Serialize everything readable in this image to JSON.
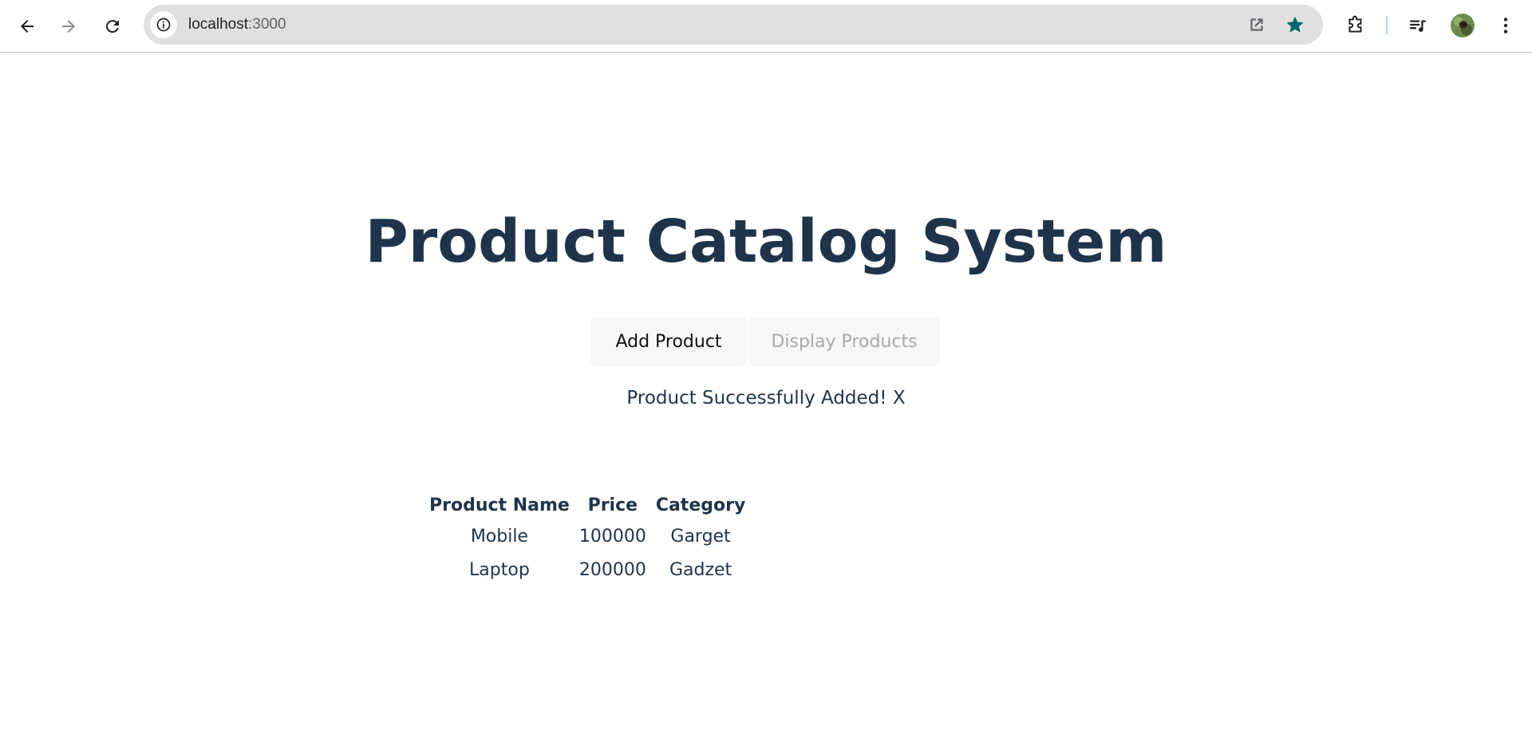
{
  "browser": {
    "url_host": "localhost",
    "url_port": ":3000",
    "accent_color": "#00696d"
  },
  "page": {
    "title": "Product Catalog System",
    "tabs": [
      {
        "label": "Add Product",
        "active": true
      },
      {
        "label": "Display Products",
        "active": false
      }
    ],
    "message": {
      "text": "Product Successfully Added!",
      "close_label": "X"
    },
    "table": {
      "headers": [
        "Product Name",
        "Price",
        "Category"
      ],
      "rows": [
        [
          "Mobile",
          "100000",
          "Garget"
        ],
        [
          "Laptop",
          "200000",
          "Gadzet"
        ]
      ]
    }
  },
  "icons": {
    "back": "arrow-left-icon",
    "forward": "arrow-right-icon",
    "reload": "reload-icon",
    "site_info": "info-icon",
    "open_external": "open-in-new-icon",
    "bookmark": "star-icon",
    "extensions": "puzzle-icon",
    "media": "media-queue-icon",
    "menu": "more-vert-icon"
  }
}
